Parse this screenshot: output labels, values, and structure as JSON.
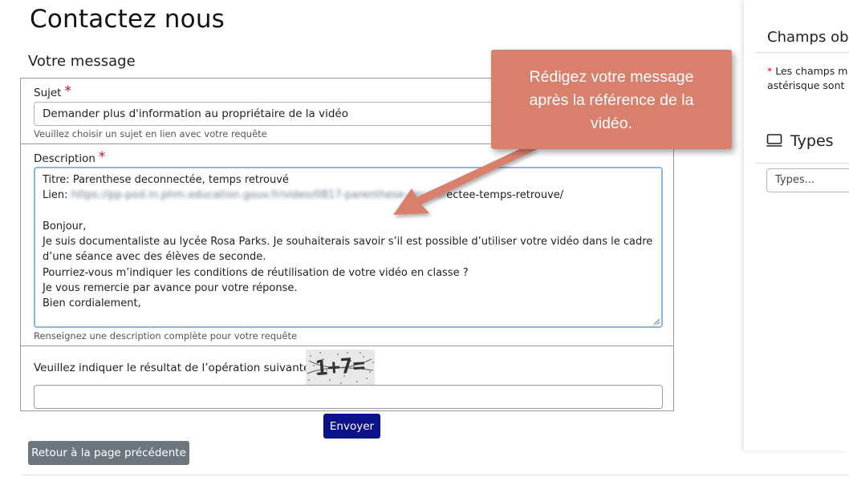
{
  "page": {
    "title": "Contactez nous",
    "section_title": "Votre message"
  },
  "form": {
    "subject": {
      "label": "Sujet",
      "required_mark": "*",
      "value": "Demander plus d'information au propriétaire de la vidéo",
      "help": "Veuillez choisir un sujet en lien avec votre requête"
    },
    "description": {
      "label": "Description",
      "required_mark": "*",
      "lines": [
        "Titre: Parenthese deconnectée, temps retrouvé",
        "Bonjour,",
        "Je suis documentaliste au lycée Rosa Parks. Je souhaiterais savoir s’il est possible d’utiliser votre vidéo dans le cadre",
        "d’une séance avec des élèves de seconde.",
        "Pourriez-vous m’indiquer les conditions de réutilisation de votre vidéo en classe ?",
        "Je vous remercie par avance pour votre réponse.",
        "Bien cordialement,"
      ],
      "link_prefix": "Lien: ",
      "link_blurred": "https://pp-pod.in.phm.education.gouv.fr/video/0817-parenthese-deconn",
      "link_visible": "ectee-temps-retrouve/",
      "help": "Renseignez une description complète pour votre requête"
    },
    "captcha": {
      "label": "Veuillez indiquer le résultat de l’opération suivante",
      "required_mark": "*",
      "image_text": "1+7="
    }
  },
  "buttons": {
    "send": "Envoyer",
    "back": "Retour à la page précédente"
  },
  "sidebar": {
    "required_title": "Champs ob",
    "required_note_star": "*",
    "required_note_line1": " Les champs m",
    "required_note_line2": "astérisque sont",
    "types_title": "Types",
    "types_placeholder": "Types..."
  },
  "callout": {
    "text_lines": [
      "Rédigez votre message",
      "après la référence de la",
      "vidéo."
    ]
  },
  "colors": {
    "accent": "#0c128a",
    "callout": "#d9806d",
    "required": "#c8102e",
    "back_button": "#6d757d",
    "focus_border": "#8ab4e8"
  }
}
